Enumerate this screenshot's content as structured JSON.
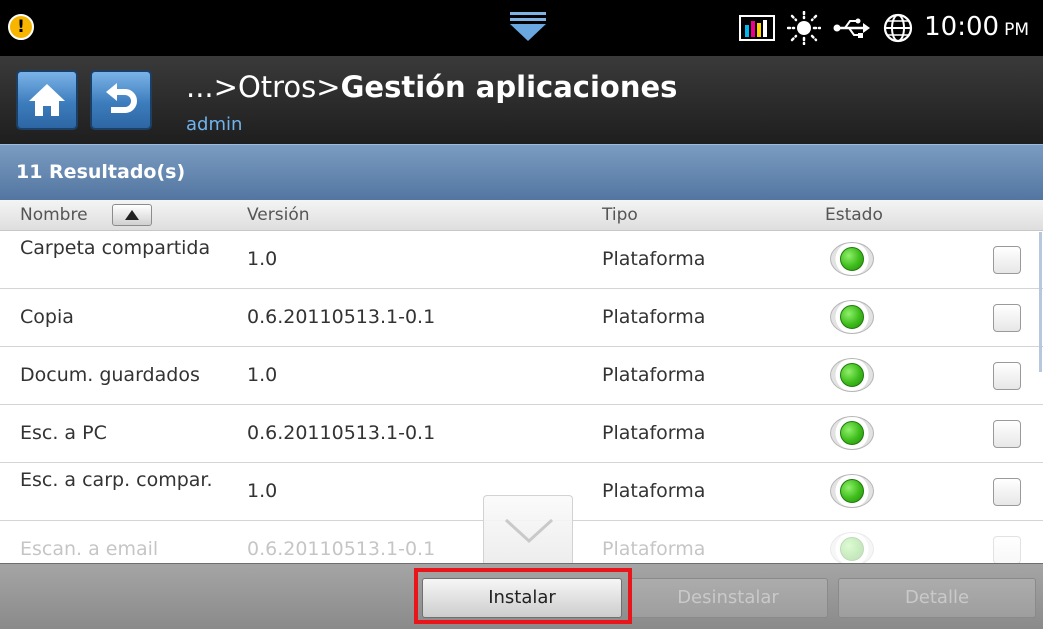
{
  "status_bar": {
    "time": "10:00",
    "ampm": "PM",
    "icons": [
      "alert-icon",
      "pull-down-icon",
      "toner-icon",
      "sun-icon",
      "usb-icon",
      "globe-icon"
    ]
  },
  "header": {
    "breadcrumb": "...>Otros>",
    "title": "Gestión aplicaciones",
    "user": "admin"
  },
  "results": {
    "label": "11 Resultado(s)"
  },
  "table": {
    "columns": {
      "name": "Nombre",
      "version": "Versión",
      "type": "Tipo",
      "status": "Estado"
    },
    "rows": [
      {
        "name": "Carpeta compartida",
        "version": "1.0",
        "type": "Plataforma",
        "status": "active"
      },
      {
        "name": "Copia",
        "version": "0.6.20110513.1-0.1",
        "type": "Plataforma",
        "status": "active"
      },
      {
        "name": "Docum. guardados",
        "version": "1.0",
        "type": "Plataforma",
        "status": "active"
      },
      {
        "name": "Esc. a PC",
        "version": "0.6.20110513.1-0.1",
        "type": "Plataforma",
        "status": "active"
      },
      {
        "name": "Esc. a carp. compar.",
        "version": "1.0",
        "type": "Plataforma",
        "status": "active"
      },
      {
        "name": "Escan. a email",
        "version": "0.6.20110513.1-0.1",
        "type": "Plataforma",
        "status": "active"
      }
    ]
  },
  "buttons": {
    "install": "Instalar",
    "uninstall": "Desinstalar",
    "detail": "Detalle"
  },
  "colors": {
    "highlight": "#e8151b",
    "status_active": "#3ebc1c",
    "accent": "#5275a0",
    "user_text": "#6fb4ec"
  }
}
